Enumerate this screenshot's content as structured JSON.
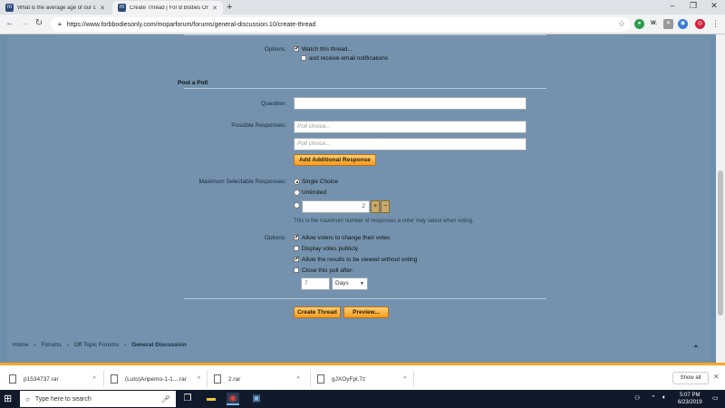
{
  "browser": {
    "tabs": [
      {
        "label": "What is the average age of our c",
        "active": false
      },
      {
        "label": "Create Thread | For B Bodies Onl",
        "active": true
      }
    ],
    "new_tab": "+",
    "url": "https://www.forbbodiesonly.com/moparforum/forums/general-discussion.10/create-thread",
    "win_min": "–",
    "win_max": "❐",
    "win_close": "✕"
  },
  "form": {
    "options_label": "Options:",
    "watch_thread": "Watch this thread...",
    "email_notifications": "and receive email notifications",
    "poll_title": "Post a Poll",
    "question_label": "Question:",
    "possible_responses_label": "Possible Responses:",
    "poll_choice_placeholder": "Poll choice...",
    "add_response_button": "Add Additional Response",
    "max_selectable_label": "Maximum Selectable Responses:",
    "single_choice": "Single Choice",
    "unlimited": "Unlimited",
    "max_value": "2",
    "max_hint": "This is the maximum number of responses a voter may select when voting.",
    "poll_options_label": "Options:",
    "allow_change": "Allow voters to change their votes",
    "display_public": "Display votes publicly",
    "allow_view": "Allow the results to be viewed without voting",
    "close_poll": "Close this poll after:",
    "close_value": "7",
    "close_unit": "Days",
    "create_button": "Create Thread",
    "preview_button": "Preview..."
  },
  "breadcrumb": {
    "items": [
      "Home",
      "Forums",
      "Off Topic Forums"
    ],
    "current": "General Discussion",
    "separator": "›"
  },
  "downloads": {
    "items": [
      "p1534737.rar",
      "(Luto)Anpemo-1-1....rar",
      "2.rar",
      "gJXOyFpl.7z"
    ],
    "show_all": "Show all"
  },
  "taskbar": {
    "search_placeholder": "Type here to search",
    "time": "5:07 PM",
    "date": "6/23/2019"
  }
}
